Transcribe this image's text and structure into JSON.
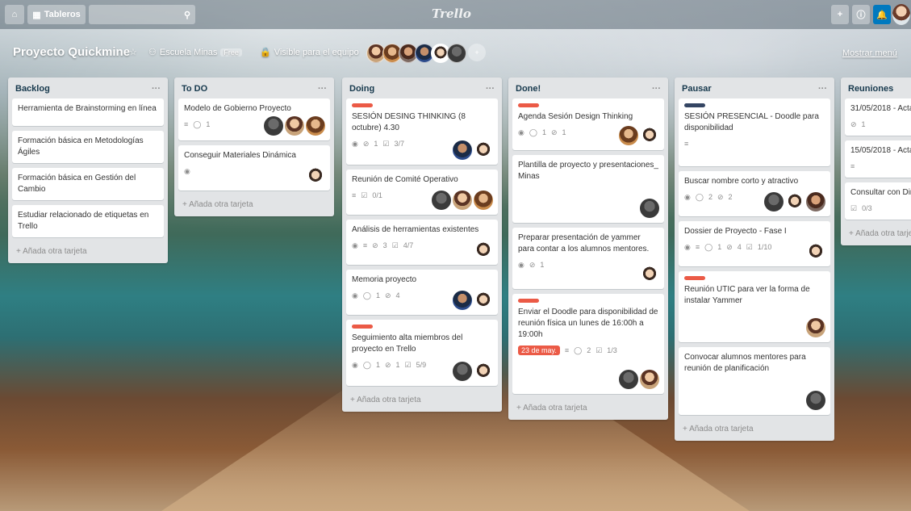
{
  "header": {
    "boards_label": "Tableros",
    "logo": "Trello",
    "board_title": "Proyecto Quickmine",
    "team": "Escuela Minas",
    "team_tag": "Free",
    "visibility": "Visible para el equipo",
    "members_extra": "+",
    "show_menu": "Mostrar menú"
  },
  "icons": {
    "home": "⌂",
    "boards": "▦",
    "search": "⚲",
    "plus": "+",
    "info": "ⓘ",
    "bell": "🔔",
    "star": "☆",
    "team": "⚇",
    "visibility": "🔒",
    "description": "≡",
    "comment": "◯",
    "attachment": "⊘",
    "checklist": "☑",
    "watch": "◉"
  },
  "accent": {
    "label_red": "#eb5a46",
    "label_dark": "#344563",
    "bell_blue": "#0079bf"
  },
  "add_card": "+ Añada otra tarjeta",
  "lists": [
    {
      "title": "Backlog",
      "menu": "···",
      "cards": [
        {
          "title": "Herramienta de Brainstorming en línea"
        },
        {
          "title": "Formación básica en Metodologías Ágiles"
        },
        {
          "title": "Formación básica en Gestión del Cambio"
        },
        {
          "title": "Estudiar relacionado de etiquetas en Trello"
        }
      ]
    },
    {
      "title": "To DO",
      "menu": "···",
      "cards": [
        {
          "title": "Modelo de Gobierno Proyecto",
          "comments": "1"
        },
        {
          "title": "Conseguir Materiales Dinámica"
        }
      ]
    },
    {
      "title": "Doing",
      "menu": "···",
      "cards": [
        {
          "title": "SESIÓN DESING THINKING (8 octubre) 4.30",
          "attachments": "1",
          "checklist": "3/7"
        },
        {
          "title": "Reunión de Comité Operativo",
          "checklist": "0/1"
        },
        {
          "title": "Análisis de herramientas existentes",
          "attachments": "3",
          "checklist": "4/7"
        },
        {
          "title": "Memoria proyecto",
          "comments": "1",
          "attachments": "4"
        },
        {
          "title": "Seguimiento alta miembros del proyecto en Trello",
          "comments": "1",
          "attachments": "1",
          "checklist": "5/9"
        }
      ]
    },
    {
      "title": "Done!",
      "menu": "···",
      "cards": [
        {
          "title": "Agenda Sesión Design Thinking",
          "comments": "1",
          "attachments": "1"
        },
        {
          "title": "Plantilla de proyecto y presentaciones_ Minas"
        },
        {
          "title": "Preparar presentación de yammer para contar a los alumnos mentores.",
          "attachments": "1"
        },
        {
          "title": "Enviar el Doodle para disponibilidad de reunión física un lunes de 16:00h a 19:00h",
          "due": "23 de may.",
          "comments": "2",
          "checklist": "1/3"
        }
      ]
    },
    {
      "title": "Pausar",
      "menu": "···",
      "cards": [
        {
          "title": "SESIÓN PRESENCIAL - Doodle para disponibilidad"
        },
        {
          "title": "Buscar nombre corto y atractivo",
          "comments": "2",
          "attachments": "2"
        },
        {
          "title": "Dossier de Proyecto - Fase I",
          "comments": "1",
          "attachments": "4",
          "checklist": "1/10"
        },
        {
          "title": "Reunión UTIC para ver la forma de instalar Yammer"
        },
        {
          "title": "Convocar alumnos mentores para reunión de planificación"
        }
      ]
    },
    {
      "title": "Reuniones",
      "cards": [
        {
          "title": "31/05/2018 - Acta",
          "attachments": "1"
        },
        {
          "title": "15/05/2018 - Acta"
        },
        {
          "title": "Consultar con Dir",
          "checklist": "0/3"
        }
      ]
    }
  ]
}
